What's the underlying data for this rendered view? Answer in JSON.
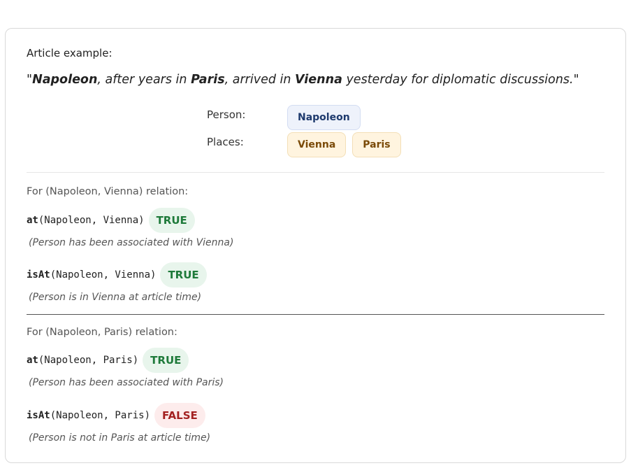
{
  "article": {
    "label": "Article example:",
    "quote_open": "\"",
    "person_name": "Napoleon",
    "text_1": ", after years in ",
    "place_1": "Paris",
    "text_2": ", arrived in ",
    "place_2": "Vienna",
    "text_3": " yesterday for diplomatic discussions.\""
  },
  "entities": {
    "person_label": "Person:",
    "persons": [
      "Napoleon"
    ],
    "places_label": "Places:",
    "places": [
      "Vienna",
      "Paris"
    ]
  },
  "sections": [
    {
      "heading": "For (Napoleon, Vienna) relation:",
      "relations": [
        {
          "fn": "at",
          "args": "(Napoleon, Vienna)",
          "result": "TRUE",
          "note": "(Person has been associated with Vienna)"
        },
        {
          "fn": "isAt",
          "args": "(Napoleon, Vienna)",
          "result": "TRUE",
          "note": "(Person is in Vienna at article time)"
        }
      ]
    },
    {
      "heading": "For (Napoleon, Paris) relation:",
      "relations": [
        {
          "fn": "at",
          "args": "(Napoleon, Paris)",
          "result": "TRUE",
          "note": "(Person has been associated with Paris)"
        },
        {
          "fn": "isAt",
          "args": "(Napoleon, Paris)",
          "result": "FALSE",
          "note": "(Person is not in Paris at article time)"
        }
      ]
    }
  ]
}
